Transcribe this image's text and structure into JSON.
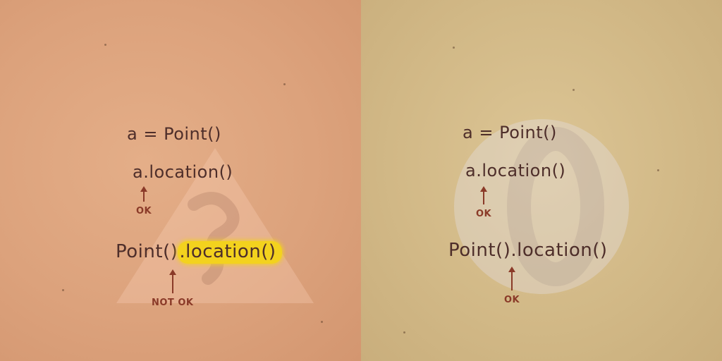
{
  "colors": {
    "left_background": "#dca27c",
    "right_background": "#d2b987",
    "code_text": "#4e2e2a",
    "annotation": "#8a3a28",
    "highlight": "#f3d21e"
  },
  "left_panel": {
    "line_assign": "a = Point()",
    "line_method": "a.location()",
    "marker_method_label": "OK",
    "line_chain_prefix": "Point()",
    "line_chain_highlighted": ".location()",
    "marker_chain_label": "NOT OK"
  },
  "right_panel": {
    "line_assign": "a = Point()",
    "line_method": "a.location()",
    "marker_method_label": "OK",
    "line_chain": "Point().location()",
    "marker_chain_label": "OK"
  }
}
